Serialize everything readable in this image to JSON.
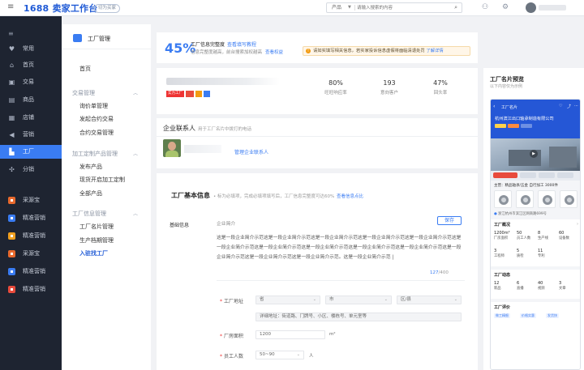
{
  "topbar": {
    "logo_num": "1688",
    "logo_text": "卖家工作台",
    "switch_label": "切为买家",
    "search_scope": "产品",
    "search_placeholder": "请输入搜索的内容"
  },
  "sidebar": {
    "items": [
      {
        "label": "常用",
        "icon": "heart-icon"
      },
      {
        "label": "首页",
        "icon": "home-icon"
      },
      {
        "label": "交易",
        "icon": "trade-icon"
      },
      {
        "label": "商品",
        "icon": "goods-icon"
      },
      {
        "label": "店铺",
        "icon": "store-icon"
      },
      {
        "label": "营销",
        "icon": "marketing-icon"
      },
      {
        "label": "工厂",
        "icon": "factory-icon"
      },
      {
        "label": "分销",
        "icon": "distribution-icon"
      }
    ],
    "apps": [
      {
        "label": "采源宝",
        "color": "#e8692d"
      },
      {
        "label": "精准营销",
        "color": "#3a7cf2"
      },
      {
        "label": "精准营销",
        "color": "#f0a020"
      },
      {
        "label": "采源宝",
        "color": "#e8692d"
      },
      {
        "label": "精准营销",
        "color": "#3a7cf2"
      },
      {
        "label": "精准营销",
        "color": "#e84b3c"
      }
    ]
  },
  "subnav": {
    "title": "工厂管理",
    "home": "首页",
    "groups": [
      {
        "title": "交易管理",
        "items": [
          "询价单管理",
          "发起合约交易",
          "合约交易管理"
        ]
      },
      {
        "title": "加工定制产品管理",
        "items": [
          "发布产品",
          "现货开启加工定制",
          "全部产品"
        ]
      },
      {
        "title": "工厂信息管理",
        "items": [
          "工厂名片管理",
          "生产档期管理",
          "入驻找工厂"
        ]
      }
    ]
  },
  "completion": {
    "percent": "45%",
    "title": "工厂信息完整度",
    "tutorial_link": "查看填写教程",
    "subtitle": "信息完整度越高，前台搜索加权越高",
    "rights_link": "查看权益",
    "notice": "请如实填写相关信息，若实家投诉信息虚假将面临清退处罚",
    "notice_link": "了解详情"
  },
  "stats": [
    {
      "value": "80%",
      "label": "旺旺响应率"
    },
    {
      "value": "193",
      "label": "意向客户"
    },
    {
      "value": "47%",
      "label": "回头率"
    }
  ],
  "contact": {
    "title": "企业联系人",
    "hint": "用于工厂名片中拨打的电话",
    "manage_link": "管理企业联系人"
  },
  "basic": {
    "title": "工厂基本信息",
    "hint": "• 标为必填项，完成必填项填写后，工厂信息完整度可达60%",
    "hint_link": "查看信息点比",
    "section": "基础信息",
    "intro_label": "企业简介",
    "save": "保存",
    "description": "这是一段企业简介示范这是一段企业简介示范这是一段企业简介示范这是一段企业简介示范这是一段企业简介示范这是一段企业简介示范这是一段企业简介示范这是一段企业简介示范这是一段企业简介示范这是一段企业简介示范这是一段企业简介示范这是一段企业简介示范这是一段企业简介示范。这是一段企业简介示范 |",
    "count_current": "127",
    "count_max": "/400",
    "address_label": "工厂地址",
    "province": "省",
    "city": "市",
    "district": "区/县",
    "address_placeholder": "详细地址：街道路、门牌号、小区、楼栋号、单元室等",
    "area_label": "厂房面积",
    "area_value": "1200",
    "area_unit": "m²",
    "staff_label": "员工人数",
    "staff_value": "50~90",
    "staff_unit": "人"
  },
  "preview": {
    "title": "工厂名片预览",
    "subtitle": "以下内容仅为示例",
    "header_label": "工厂名片",
    "company": "杭州滨江出口轴承制造有限公司",
    "product_line": "主营：精品轴承/五金  自行加工  3000件",
    "address": "浙江杭州市滨江区网商路699号",
    "block1_title": "工厂概况",
    "block1_more": "›",
    "metrics": [
      {
        "v": "1200m²",
        "k": "厂房面积"
      },
      {
        "v": "50",
        "k": "员工人数"
      },
      {
        "v": "8",
        "k": "生产线"
      },
      {
        "v": "60",
        "k": "设备数"
      }
    ],
    "metrics2": [
      {
        "v": "3",
        "k": "工程师"
      },
      {
        "v": "5",
        "k": "质检"
      },
      {
        "v": "11",
        "k": "专利"
      }
    ],
    "block2_title": "工厂动态",
    "dyn": [
      {
        "v": "12",
        "k": "新品"
      },
      {
        "v": "6",
        "k": "直播"
      },
      {
        "v": "40",
        "k": "视频"
      },
      {
        "v": "3",
        "k": "文章"
      }
    ],
    "block3_title": "工厂评价",
    "pills": [
      "做工精细",
      "价格实惠",
      "发货快"
    ]
  }
}
